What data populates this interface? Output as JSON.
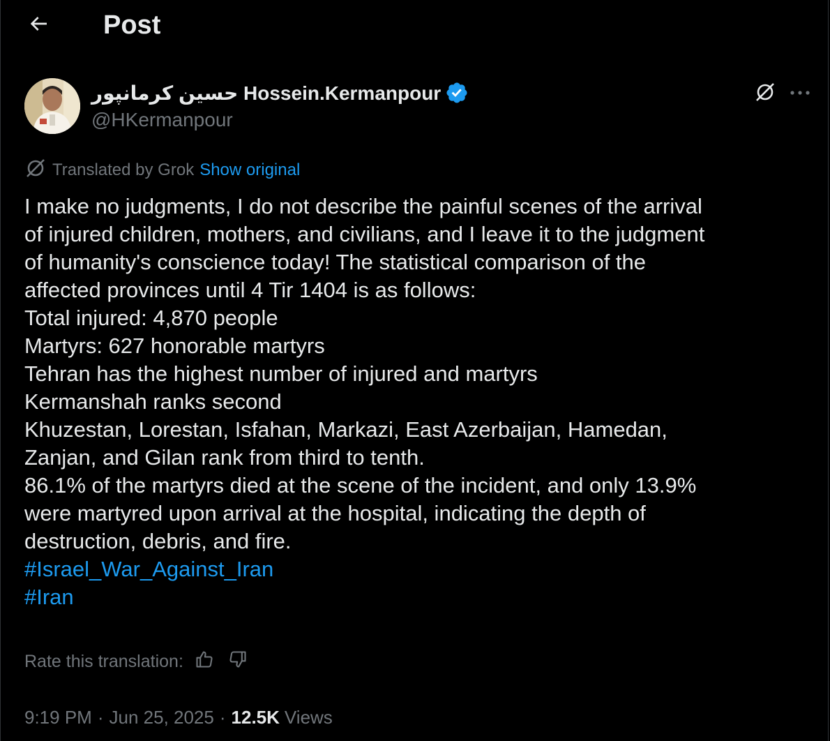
{
  "colors": {
    "background": "#000000",
    "text": "#e7e9ea",
    "muted": "#71767b",
    "accent": "#1d9bf0",
    "verified": "#1d9bf0"
  },
  "header": {
    "back_icon": "arrow-left-icon",
    "title": "Post"
  },
  "author": {
    "name": "حسین کرمانپور Hossein.Kermanpour",
    "handle": "@HKermanpour",
    "verified_icon": "verified-badge-icon"
  },
  "translation": {
    "icon": "grok-icon",
    "label": "Translated by Grok",
    "show_original": "Show original"
  },
  "post": {
    "lines": [
      "I make no judgments, I do not describe the painful scenes of the arrival",
      "of injured children, mothers, and civilians, and I leave it to the judgment",
      "of humanity's conscience today! The statistical comparison of the",
      "affected provinces until 4 Tir 1404 is as follows:",
      "Total injured: 4,870 people",
      "Martyrs: 627 honorable martyrs",
      "Tehran has the highest number of injured and martyrs",
      "Kermanshah ranks second",
      "Khuzestan, Lorestan, Isfahan, Markazi, East Azerbaijan, Hamedan,",
      "Zanjan, and Gilan rank from third to tenth.",
      "86.1% of the martyrs died at the scene of the incident, and only 13.9%",
      "were martyred upon arrival at the hospital, indicating the depth of",
      "destruction, debris, and fire."
    ],
    "hashtags": [
      "#Israel_War_Against_Iran",
      "#Iran"
    ]
  },
  "rating": {
    "label": "Rate this translation:",
    "thumbs_up_icon": "thumbs-up-icon",
    "thumbs_down_icon": "thumbs-down-icon"
  },
  "meta": {
    "time": "9:19 PM",
    "separator": "·",
    "date": "Jun 25, 2025",
    "views_count": "12.5K",
    "views_label": "Views"
  }
}
